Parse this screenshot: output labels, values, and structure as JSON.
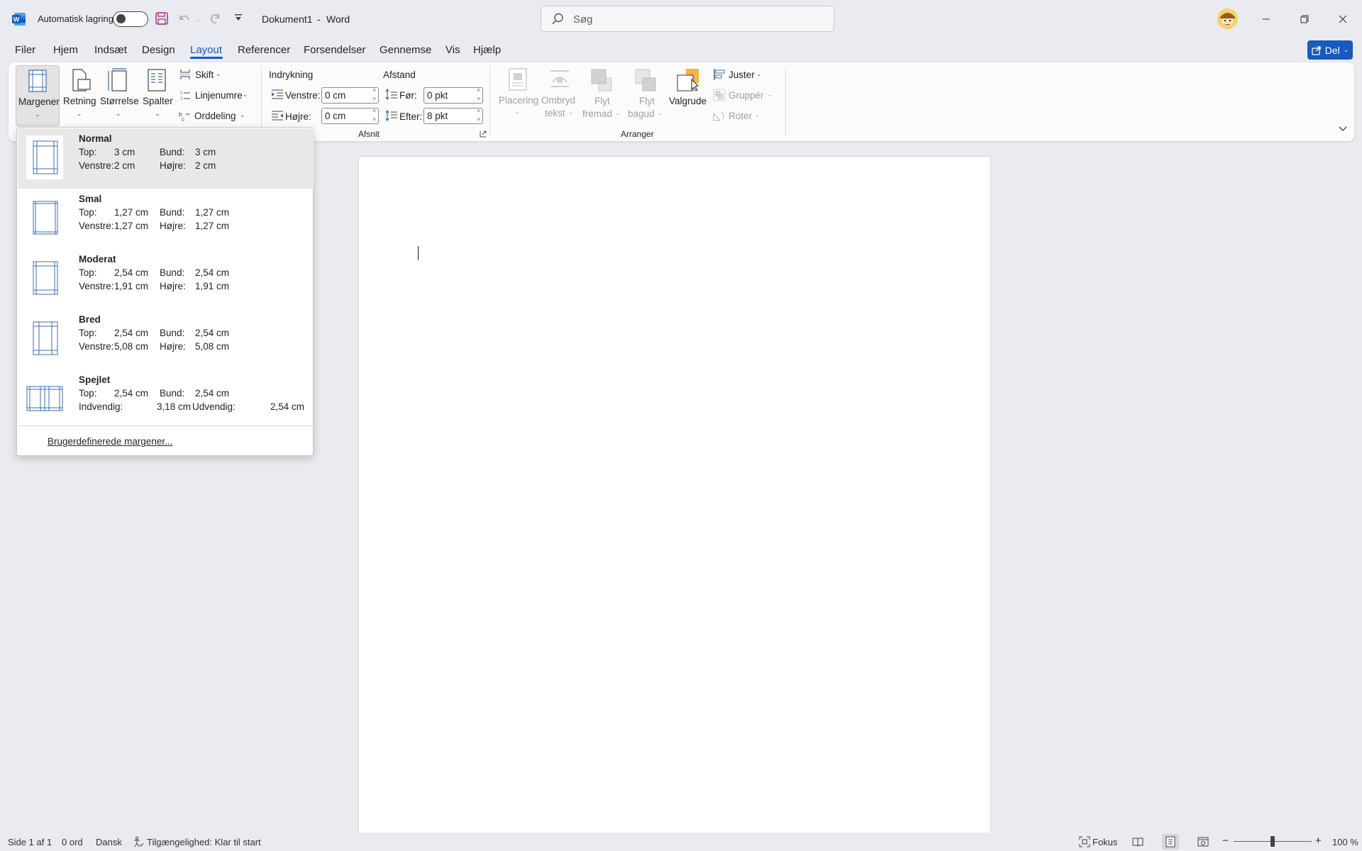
{
  "titlebar": {
    "autosave_label": "Automatisk lagring",
    "doc_title": "Dokument1",
    "separator": "-",
    "app_name": "Word",
    "search_placeholder": "Søg"
  },
  "menu": {
    "tabs": [
      "Filer",
      "Hjem",
      "Indsæt",
      "Design",
      "Layout",
      "Referencer",
      "Forsendelser",
      "Gennemse",
      "Vis",
      "Hjælp"
    ],
    "active": "Layout",
    "share_label": "Del"
  },
  "ribbon": {
    "margins": "Margener",
    "orientation": "Retning",
    "size": "Størrelse",
    "columns": "Spalter",
    "breaks": "Skift",
    "line_numbers": "Linjenumre",
    "hyphenation": "Orddeling",
    "indent_header": "Indrykning",
    "spacing_header": "Afstand",
    "left_label": "Venstre:",
    "left_value": "0 cm",
    "right_label": "Højre:",
    "right_value": "0 cm",
    "before_label": "Før:",
    "before_value": "0 pkt",
    "after_label": "Efter:",
    "after_value": "8 pkt",
    "paragraph_group": "Afsnit",
    "position_1": "Placering",
    "wrap_1": "Ombryd",
    "wrap_2": "tekst",
    "forward_1": "Flyt",
    "forward_2": "fremad",
    "backward_1": "Flyt",
    "backward_2": "bagud",
    "selection_pane": "Valgrude",
    "align": "Juster",
    "group": "Gruppér",
    "rotate": "Roter",
    "arrange_group": "Arranger"
  },
  "margins_menu": {
    "options": [
      {
        "name": "Normal",
        "l1": "Top:",
        "v1": "3 cm",
        "l2": "Bund:",
        "v2": "3 cm",
        "l3": "Venstre:",
        "v3": "2 cm",
        "l4": "Højre:",
        "v4": "2 cm"
      },
      {
        "name": "Smal",
        "l1": "Top:",
        "v1": "1,27 cm",
        "l2": "Bund:",
        "v2": "1,27 cm",
        "l3": "Venstre:",
        "v3": "1,27 cm",
        "l4": "Højre:",
        "v4": "1,27 cm"
      },
      {
        "name": "Moderat",
        "l1": "Top:",
        "v1": "2,54 cm",
        "l2": "Bund:",
        "v2": "2,54 cm",
        "l3": "Venstre:",
        "v3": "1,91 cm",
        "l4": "Højre:",
        "v4": "1,91 cm"
      },
      {
        "name": "Bred",
        "l1": "Top:",
        "v1": "2,54 cm",
        "l2": "Bund:",
        "v2": "2,54 cm",
        "l3": "Venstre:",
        "v3": "5,08 cm",
        "l4": "Højre:",
        "v4": "5,08 cm"
      },
      {
        "name": "Spejlet",
        "l1": "Top:",
        "v1": "2,54 cm",
        "l2": "Bund:",
        "v2": "2,54 cm",
        "l3": "Indvendig:",
        "v3": "3,18 cm",
        "l4": "Udvendig:",
        "v4": "2,54 cm"
      }
    ],
    "custom_label": "Brugerdefinerede margener..."
  },
  "statusbar": {
    "page": "Side 1 af 1",
    "words": "0 ord",
    "language": "Dansk",
    "accessibility": "Tilgængelighed: Klar til start",
    "focus": "Fokus",
    "zoom": "100 %"
  },
  "colors": {
    "accent": "#185abd",
    "page": "#ffffff",
    "background": "#e9ebf0"
  }
}
